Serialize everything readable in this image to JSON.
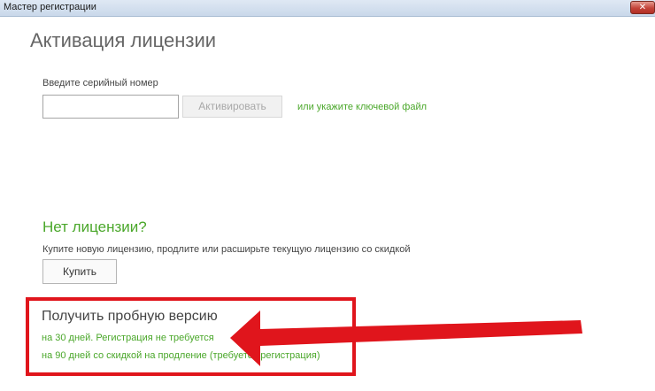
{
  "window": {
    "title": "Мастер регистрации",
    "close_symbol": "✕"
  },
  "main": {
    "page_title": "Активация лицензии",
    "serial": {
      "label": "Введите серийный номер",
      "value": "",
      "placeholder": ""
    },
    "activate_label": "Активировать",
    "keyfile_link": "или укажите ключевой файл"
  },
  "no_license": {
    "heading": "Нет лицензии?",
    "description": "Купите новую лицензию, продлите или расширьте текущую лицензию со скидкой",
    "buy_label": "Купить"
  },
  "trial": {
    "heading": "Получить пробную версию",
    "option_30": "на 30 дней. Регистрация не требуется",
    "option_90": "на 90 дней со скидкой на продление (требуется регистрация)"
  },
  "annotation": {
    "highlight_color": "#e0151c",
    "arrow_color": "#e0151c"
  },
  "colors": {
    "link_green": "#4aa72a",
    "title_gray": "#666666"
  }
}
